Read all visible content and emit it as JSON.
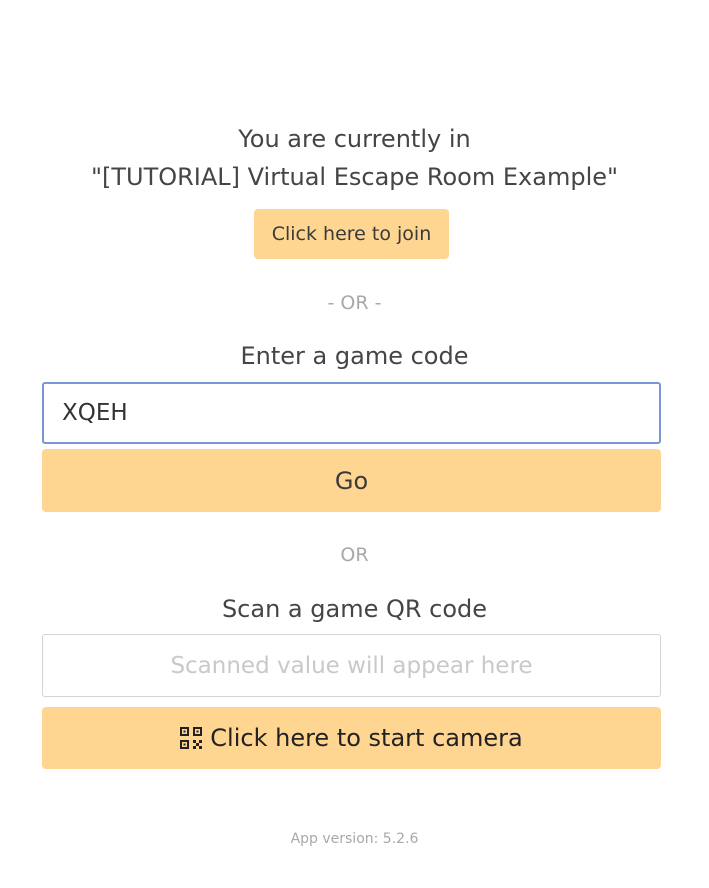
{
  "current_game": {
    "line1": "You are currently in",
    "line2": "\"[TUTORIAL] Virtual Escape Room Example\"",
    "join_label": "Click here to join"
  },
  "separator_top": "- OR -",
  "game_code": {
    "label": "Enter a game code",
    "value": "XQEH",
    "go_label": "Go"
  },
  "separator_bottom": "OR",
  "qr_scan": {
    "label": "Scan a game QR code",
    "placeholder": "Scanned value will appear here",
    "camera_label": "Click here to start camera",
    "icon": "qrcode-icon"
  },
  "footer": {
    "version": "App version: 5.2.6"
  },
  "colors": {
    "accent": "#ffd592",
    "focus_border": "#7b95d6",
    "muted_text": "#a8a8a8"
  }
}
